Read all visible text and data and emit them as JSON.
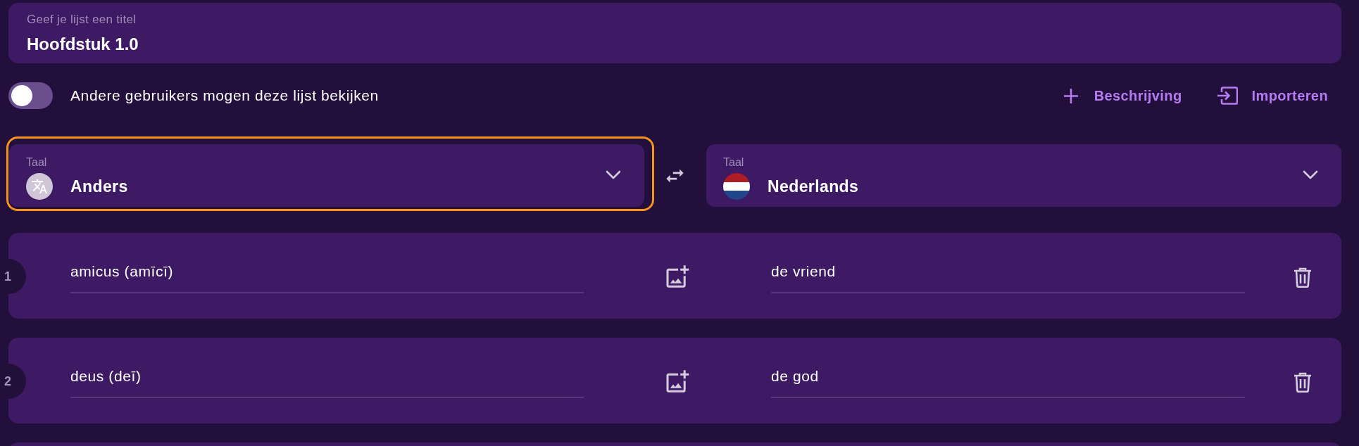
{
  "title_field": {
    "label": "Geef je lijst een titel",
    "value": "Hoofdstuk 1.0"
  },
  "visibility_toggle": {
    "label": "Andere gebruikers mogen deze lijst bekijken",
    "on": false
  },
  "actions": [
    {
      "kind": "add",
      "label": "Beschrijving"
    },
    {
      "kind": "import",
      "label": "Importeren"
    }
  ],
  "languages": [
    {
      "label": "Taal",
      "value": "Anders",
      "kind": "translate",
      "focused": true
    },
    {
      "label": "Taal",
      "value": "Nederlands",
      "kind": "flag",
      "focused": false
    }
  ],
  "rows": [
    {
      "number": "1",
      "term": "amicus (amīcī)",
      "definition": "de vriend"
    },
    {
      "number": "2",
      "term": "deus (deī)",
      "definition": "de god"
    }
  ]
}
